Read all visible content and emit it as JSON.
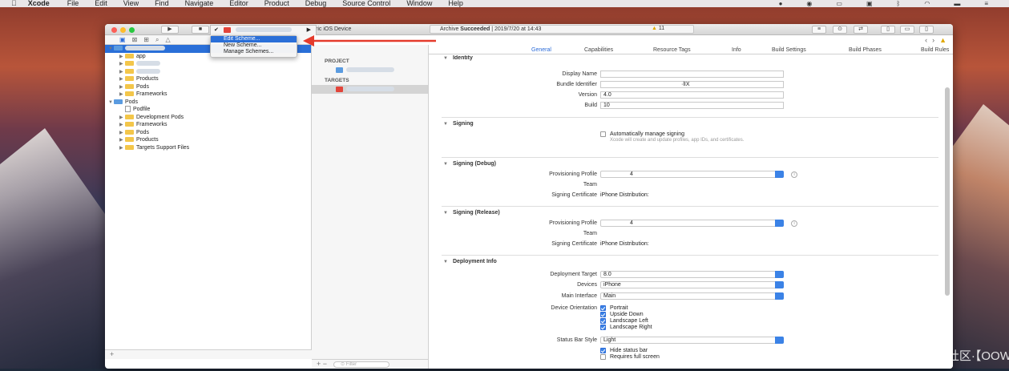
{
  "menubar": {
    "apple": "",
    "app": "Xcode",
    "items": [
      "File",
      "Edit",
      "View",
      "Find",
      "Navigate",
      "Editor",
      "Product",
      "Debug",
      "Source Control",
      "Window",
      "Help"
    ]
  },
  "toolbar": {
    "run": "▶",
    "stop": "■",
    "destination": "ric iOS Device",
    "activity_prefix": "Archive",
    "activity_status": "Succeeded",
    "activity_sep": "|",
    "activity_time": "2019/7/20 at 14:43",
    "warnings": "11"
  },
  "scheme_menu": {
    "check": "✔",
    "submenu": "▶",
    "items": [
      "Edit Scheme...",
      "New Scheme...",
      "Manage Schemes..."
    ]
  },
  "navigator": {
    "items": [
      {
        "indent": 0,
        "tri": "▼",
        "type": "bproj",
        "label": "",
        "blur": 50,
        "sel": true
      },
      {
        "indent": 1,
        "tri": "▶",
        "type": "folder",
        "label": "app",
        "blur": 0
      },
      {
        "indent": 1,
        "tri": "▶",
        "type": "folder",
        "label": "",
        "blur": 30
      },
      {
        "indent": 1,
        "tri": "▶",
        "type": "folder",
        "label": "",
        "blur": 30
      },
      {
        "indent": 1,
        "tri": "▶",
        "type": "folder",
        "label": "Products",
        "blur": 0
      },
      {
        "indent": 1,
        "tri": "▶",
        "type": "folder",
        "label": "Pods",
        "blur": 0
      },
      {
        "indent": 1,
        "tri": "▶",
        "type": "folder",
        "label": "Frameworks",
        "blur": 0
      },
      {
        "indent": 0,
        "tri": "▼",
        "type": "bproj",
        "label": "Pods",
        "blur": 0
      },
      {
        "indent": 1,
        "tri": "",
        "type": "doc",
        "label": "Podfile",
        "blur": 0
      },
      {
        "indent": 1,
        "tri": "▶",
        "type": "folder",
        "label": "Development Pods",
        "blur": 0
      },
      {
        "indent": 1,
        "tri": "▶",
        "type": "folder",
        "label": "Frameworks",
        "blur": 0
      },
      {
        "indent": 1,
        "tri": "▶",
        "type": "folder",
        "label": "Pods",
        "blur": 0
      },
      {
        "indent": 1,
        "tri": "▶",
        "type": "folder",
        "label": "Products",
        "blur": 0
      },
      {
        "indent": 1,
        "tri": "▶",
        "type": "folder",
        "label": "Targets Support Files",
        "blur": 0
      }
    ]
  },
  "targets_panel": {
    "project_header": "PROJECT",
    "targets_header": "TARGETS"
  },
  "tabs": [
    "General",
    "Capabilities",
    "Resource Tags",
    "Info",
    "Build Settings",
    "Build Phases",
    "Build Rules"
  ],
  "identity": {
    "title": "Identity",
    "display_name_label": "Display Name",
    "bundle_id_label": "Bundle Identifier",
    "bundle_id_suffix": "·lIX",
    "version_label": "Version",
    "version": "4.0",
    "build_label": "Build",
    "build": "10"
  },
  "signing": {
    "title": "Signing",
    "auto_label": "Automatically manage signing",
    "note": "Xcode will create and update profiles, app IDs, and certificates."
  },
  "signing_debug": {
    "title": "Signing (Debug)",
    "profile_label": "Provisioning Profile",
    "profile": "4",
    "team_label": "Team",
    "cert_label": "Signing Certificate",
    "cert": "iPhone Distribution:"
  },
  "signing_release": {
    "title": "Signing (Release)",
    "profile_label": "Provisioning Profile",
    "profile": "4",
    "team_label": "Team",
    "cert_label": "Signing Certificate",
    "cert": "iPhone Distribution:"
  },
  "deployment": {
    "title": "Deployment Info",
    "target_label": "Deployment Target",
    "target": "8.0",
    "devices_label": "Devices",
    "devices": "iPhone",
    "main_label": "Main Interface",
    "main": "Main",
    "orientation_label": "Device Orientation",
    "orientations": [
      "Portrait",
      "Upside Down",
      "Landscape Left",
      "Landscape Right"
    ],
    "status_label": "Status Bar Style",
    "status": "Light",
    "hide_status": "Hide status bar",
    "requires_full": "Requires full screen"
  },
  "watermark": "CSDN @北京前端—掘金技术社区·【OOW】",
  "colors": {
    "accent": "#2a6fd8",
    "warning": "#e0a800",
    "arrow": "#e53b2c"
  }
}
